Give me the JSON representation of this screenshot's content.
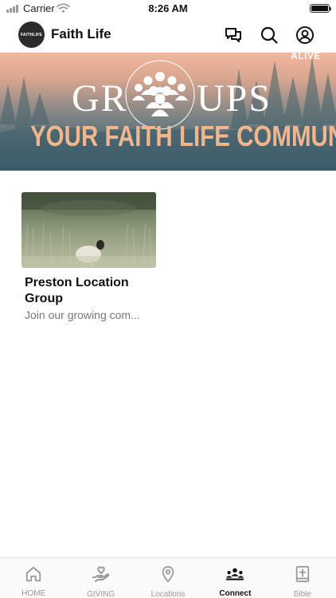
{
  "status_bar": {
    "carrier": "Carrier",
    "time": "8:26 AM"
  },
  "header": {
    "avatar_text": "FAITHLIFE",
    "title": "Faith Life",
    "icons": [
      "chat-icon",
      "search-icon",
      "account-icon"
    ]
  },
  "banner": {
    "corner_text": "ALIVE",
    "title_left": "GR",
    "title_right": "UPS",
    "subtitle": "YOUR FAITH LIFE COMMUNITY"
  },
  "groups": [
    {
      "title": "Preston Location Group",
      "description": "Join our growing com..."
    }
  ],
  "tabs": [
    {
      "label": "HOME",
      "icon": "home-icon",
      "active": false
    },
    {
      "label": "GIVING",
      "icon": "giving-hand-heart-icon",
      "active": false
    },
    {
      "label": "Locations",
      "icon": "location-pin-icon",
      "active": false
    },
    {
      "label": "Connect",
      "icon": "people-group-icon",
      "active": true
    },
    {
      "label": "Bible",
      "icon": "bible-icon",
      "active": false
    }
  ],
  "colors": {
    "banner_subtitle": "#f2b68e",
    "active_tab": "#111111",
    "inactive_tab": "#9a9a9a"
  }
}
